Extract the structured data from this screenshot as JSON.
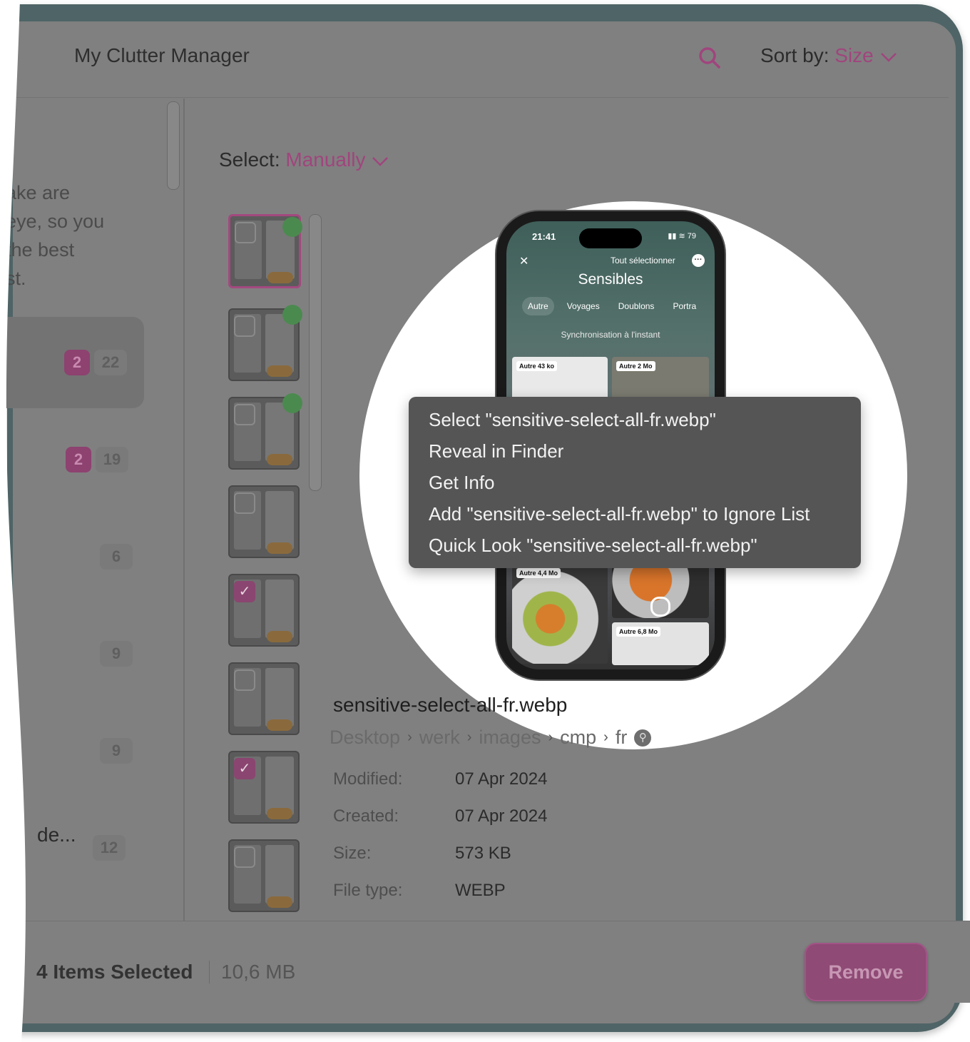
{
  "header": {
    "title": "My Clutter Manager",
    "sort_label": "Sort by:",
    "sort_value": "Size"
  },
  "sidebar": {
    "blurb_lines": [
      "ake are",
      "eye, so you",
      "the best",
      "st."
    ],
    "categories": [
      {
        "selected": "2",
        "total": "22"
      },
      {
        "selected": "2",
        "total": "19"
      },
      {
        "total": "6"
      },
      {
        "total": "9"
      },
      {
        "total": "9"
      },
      {
        "name": "de...",
        "total": "12"
      }
    ]
  },
  "select": {
    "label": "Select:",
    "value": "Manually"
  },
  "phone": {
    "time": "21:41",
    "battery": "79",
    "select_all": "Tout sélectionner",
    "title": "Sensibles",
    "tabs": [
      "Autre",
      "Voyages",
      "Doublons",
      "Portra"
    ],
    "sync": "Synchronisation à l'instant",
    "tags": [
      "Autre 43 ko",
      "Autre 2 Mo",
      "Autre 4,4 Mo",
      "Autre 6,8 Mo"
    ]
  },
  "context_menu": {
    "items": [
      "Select \"sensitive-select-all-fr.webp\"",
      "Reveal in Finder",
      "Get Info",
      "Add \"sensitive-select-all-fr.webp\" to Ignore List",
      "Quick Look \"sensitive-select-all-fr.webp\""
    ]
  },
  "detail": {
    "filename": "sensitive-select-all-fr.webp",
    "path": [
      "Desktop",
      "werk",
      "images",
      "cmp",
      "fr"
    ],
    "fields": [
      {
        "label": "Modified:",
        "value": "07 Apr 2024"
      },
      {
        "label": "Created:",
        "value": "07 Apr 2024"
      },
      {
        "label": "Size:",
        "value": "573 KB"
      },
      {
        "label": "File type:",
        "value": "WEBP"
      }
    ]
  },
  "footer": {
    "selected_count": "4 Items Selected",
    "selected_size": "10,6 MB",
    "remove_label": "Remove"
  },
  "colors": {
    "accent": "#a0457d",
    "window_border": "#4f6466",
    "overlay": "#808080"
  }
}
